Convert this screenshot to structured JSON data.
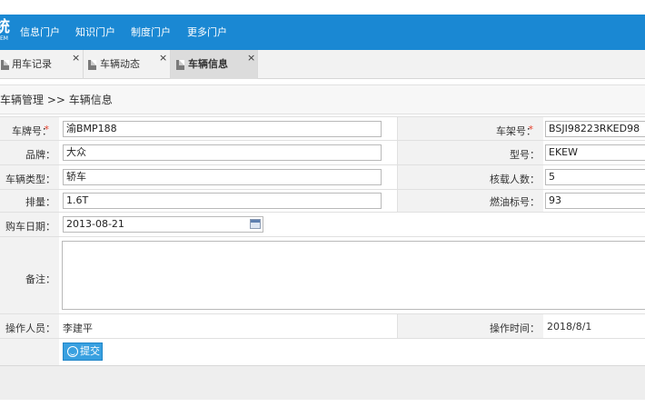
{
  "logo": {
    "big": "统",
    "small": "EM"
  },
  "nav": [
    "信息门户",
    "知识门户",
    "制度门户",
    "更多门户"
  ],
  "tabs": [
    {
      "label": "用车记录",
      "close": "×"
    },
    {
      "label": "车辆动态",
      "close": "×"
    },
    {
      "label": "车辆信息",
      "close": "×"
    }
  ],
  "breadcrumb": "车辆管理 >> 车辆信息",
  "required_mark": "*",
  "form": {
    "plate_label": "车牌号：",
    "plate_value": "渝BMP188",
    "frame_label": "车架号：",
    "frame_value": "BSJI98223RKED98",
    "brand_label": "品牌：",
    "brand_value": "大众",
    "model_label": "型号：",
    "model_value": "EKEW",
    "type_label": "车辆类型：",
    "type_value": "轿车",
    "seats_label": "核载人数：",
    "seats_value": "5",
    "displacement_label": "排量：",
    "displacement_value": "1.6T",
    "fuel_label": "燃油标号：",
    "fuel_value": "93",
    "purchase_label": "购车日期：",
    "purchase_value": "2013-08-21",
    "remark_label": "备注：",
    "remark_value": "",
    "operator_label": "操作人员：",
    "operator_value": "李建平",
    "optime_label": "操作时间：",
    "optime_value": "2018/8/1"
  },
  "submit_label": "提交"
}
